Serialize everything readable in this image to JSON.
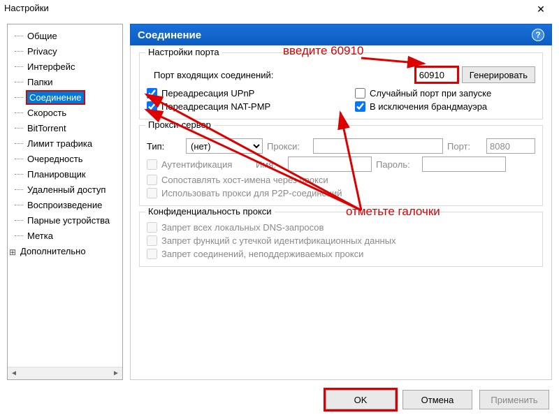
{
  "window": {
    "title": "Настройки"
  },
  "sidebar": {
    "items": [
      {
        "label": "Общие"
      },
      {
        "label": "Privacy"
      },
      {
        "label": "Интерфейс"
      },
      {
        "label": "Папки"
      },
      {
        "label": "Соединение",
        "selected": true
      },
      {
        "label": "Скорость"
      },
      {
        "label": "BitTorrent"
      },
      {
        "label": "Лимит трафика"
      },
      {
        "label": "Очередность"
      },
      {
        "label": "Планировщик"
      },
      {
        "label": "Удаленный доступ"
      },
      {
        "label": "Воспроизведение"
      },
      {
        "label": "Парные устройства"
      },
      {
        "label": "Метка"
      },
      {
        "label": "Дополнительно",
        "plus": true
      }
    ]
  },
  "panel": {
    "title": "Соединение",
    "port": {
      "group_label": "Настройки порта",
      "port_label": "Порт входящих соединений:",
      "port_value": "60910",
      "generate_btn": "Генерировать",
      "upnp": "Переадресация UPnP",
      "natpmp": "Переадресация NAT-PMP",
      "random": "Случайный порт при запуске",
      "firewall": "В исключения брандмауэра"
    },
    "proxy": {
      "group_label": "Прокси-сервер",
      "type_label": "Тип:",
      "type_value": "(нет)",
      "proxy_label": "Прокси:",
      "port2_label": "Порт:",
      "port2_value": "8080",
      "auth": "Аутентификация",
      "name_label": "Имя:",
      "pass_label": "Пароль:",
      "hostnames": "Сопоставлять хост-имена через прокси",
      "p2p": "Использовать прокси для P2P-соединений"
    },
    "privacy": {
      "group_label": "Конфиденциальность прокси",
      "dns": "Запрет всех локальных DNS-запросов",
      "leak": "Запрет функций с утечкой идентификационных данных",
      "unsupported": "Запрет соединений, неподдерживаемых прокси"
    }
  },
  "annotations": {
    "enter_port": "введите 60910",
    "check_boxes": "отметьте галочки"
  },
  "buttons": {
    "ok": "OK",
    "cancel": "Отмена",
    "apply": "Применить"
  }
}
